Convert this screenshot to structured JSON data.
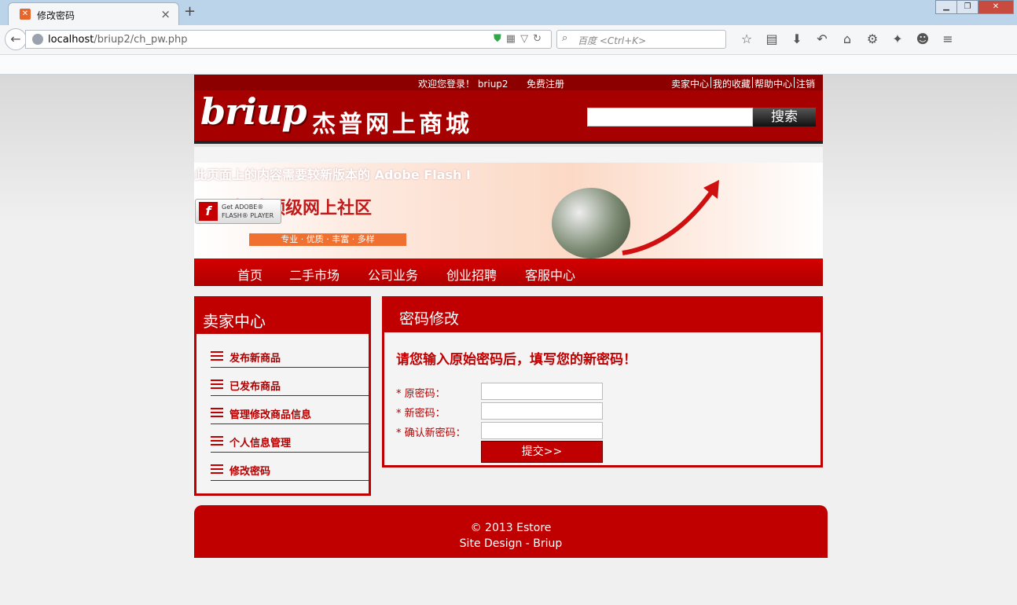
{
  "browser": {
    "tab_title": "修改密码",
    "url_host": "localhost",
    "url_path": "/briup2/ch_pw.php",
    "search_placeholder": "百度 <Ctrl+K>"
  },
  "header": {
    "welcome": "欢迎您登录！ briup2",
    "register": "免费注册",
    "links": [
      "卖家中心",
      "我的收藏",
      "帮助中心",
      "注销"
    ],
    "logo": "briup",
    "logo_cn": "杰普网上商城",
    "search_button": "搜索"
  },
  "banner": {
    "flash_message": "此页面上的内容需要较新版本的 Adobe Flash Player。",
    "slogan": "打造顶级网上社区",
    "sub": "专业 · 优质 · 丰富 · 多样",
    "flash_get": "Get ADOBE®",
    "flash_player": "FLASH® PLAYER"
  },
  "nav": {
    "items": [
      "首页",
      "二手市场",
      "公司业务",
      "创业招聘",
      "客服中心"
    ]
  },
  "sidebar": {
    "title": "卖家中心",
    "items": [
      "发布新商品",
      "已发布商品",
      "管理修改商品信息",
      "个人信息管理",
      "修改密码"
    ]
  },
  "panel": {
    "title": "密码修改",
    "instruction": "请您输入原始密码后，填写您的新密码！",
    "fields": [
      {
        "label": "* 原密码：",
        "value": ""
      },
      {
        "label": "* 新密码：",
        "value": ""
      },
      {
        "label": "* 确认新密码：",
        "value": ""
      }
    ],
    "submit": "提交>>"
  },
  "footer": {
    "copyright": "© 2013 Estore",
    "design": "Site Design - Briup"
  },
  "colors": {
    "brand_red": "#c00000",
    "dark_red": "#a70000"
  }
}
